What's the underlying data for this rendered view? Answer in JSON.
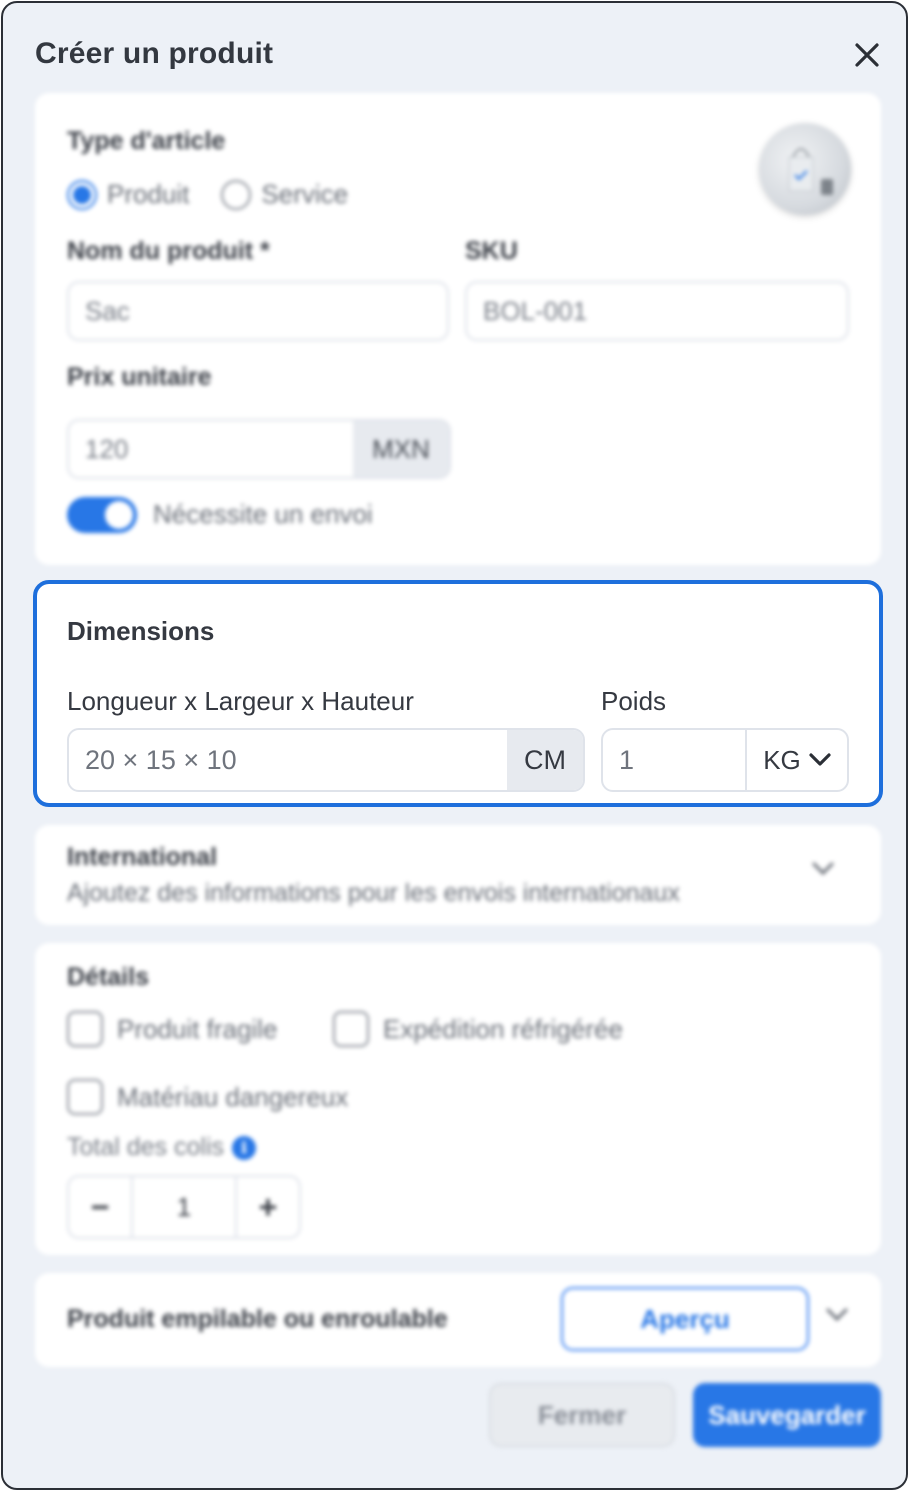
{
  "modal": {
    "title": "Créer un produit"
  },
  "item_type": {
    "label": "Type d'article",
    "options": [
      "Produit",
      "Service"
    ],
    "selected": "Produit"
  },
  "product_name": {
    "label": "Nom du produit *",
    "value": "Sac"
  },
  "sku": {
    "label": "SKU",
    "value": "BOL-001"
  },
  "unit_price": {
    "label": "Prix unitaire",
    "value": "120",
    "currency": "MXN"
  },
  "shipping_toggle": {
    "label": "Nécessite un envoi",
    "on": true
  },
  "dimensions": {
    "title": "Dimensions",
    "lwh_label": "Longueur x Largeur x Hauteur",
    "lwh_value": "20 × 15 × 10",
    "lwh_unit": "CM",
    "weight_label": "Poids",
    "weight_value": "1",
    "weight_unit": "KG"
  },
  "international": {
    "title": "International",
    "subtitle": "Ajoutez des informations pour les envois internationaux"
  },
  "details": {
    "title": "Détails",
    "checkboxes": [
      "Produit fragile",
      "Expédition réfrigérée",
      "Matériau dangereux"
    ],
    "total_label": "Total des colis",
    "total_value": "1",
    "minus": "−",
    "plus": "+",
    "info_glyph": "i"
  },
  "stackable": {
    "label": "Produit empilable ou enroulable",
    "preview_button": "Aperçu"
  },
  "footer": {
    "close_label": "Fermer",
    "save_label": "Sauvegarder"
  },
  "colors": {
    "accent": "#2877e6",
    "highlight_border": "#1e6fdc",
    "background": "#edf1f7"
  }
}
